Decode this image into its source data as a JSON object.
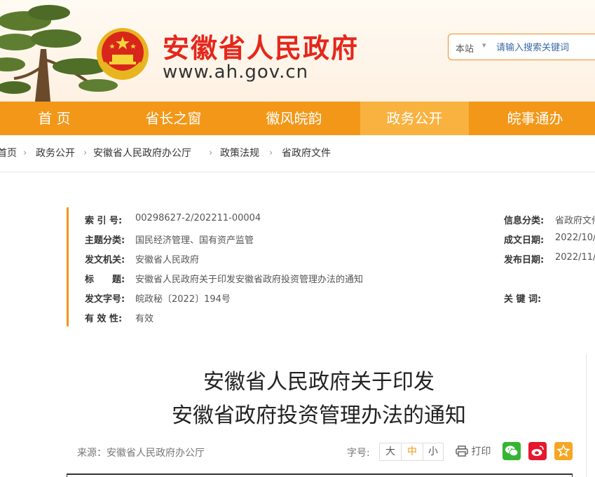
{
  "site": {
    "title": "安徽省人民政府",
    "url": "www.ah.gov.cn"
  },
  "search": {
    "scope": "本站",
    "placeholder": "请输入搜索关键词"
  },
  "nav": {
    "items": [
      {
        "label": "首  页"
      },
      {
        "label": "省长之窗"
      },
      {
        "label": "徽风皖韵"
      },
      {
        "label": "政务公开"
      },
      {
        "label": "皖事通办"
      }
    ],
    "active_index": 3
  },
  "breadcrumb": [
    "首页",
    "政务公开",
    "安徽省人民政府办公厅",
    "政策法规",
    "省政府文件"
  ],
  "info": {
    "left": [
      {
        "label": "索 引 号:",
        "value": "00298627-2/202211-00004"
      },
      {
        "label": "主题分类:",
        "value": "国民经济管理、国有资产监管"
      },
      {
        "label": "发文机关:",
        "value": "安徽省人民政府"
      },
      {
        "label": "标　　题:",
        "value": "安徽省人民政府关于印发安徽省政府投资管理办法的通知"
      },
      {
        "label": "发文字号:",
        "value": "皖政秘〔2022〕194号"
      },
      {
        "label": "有 效 性:",
        "value": "有效"
      }
    ],
    "right": [
      {
        "label": "信息分类:",
        "value": "省政府文件"
      },
      {
        "label": "成文日期:",
        "value": "2022/10/"
      },
      {
        "label": "发布日期:",
        "value": "2022/11/"
      },
      {
        "label": "关 键 词:",
        "value": ""
      }
    ]
  },
  "article": {
    "title_line1": "安徽省人民政府关于印发",
    "title_line2": "安徽省政府投资管理办法的通知",
    "source": "来源：安徽省人民政府办公厅"
  },
  "tools": {
    "font_size_label": "字号:",
    "sizes": [
      "大",
      "中",
      "小"
    ],
    "print_label": "打印",
    "share_icons": [
      "wechat-icon",
      "weibo-icon",
      "favorite-icon"
    ]
  },
  "colors": {
    "brand_red": "#e5271c",
    "nav_orange": "#f39718",
    "nav_active": "#f9b23f",
    "wechat_green": "#35b534",
    "weibo_red": "#e6162d",
    "favorite_orange": "#f7a623"
  }
}
